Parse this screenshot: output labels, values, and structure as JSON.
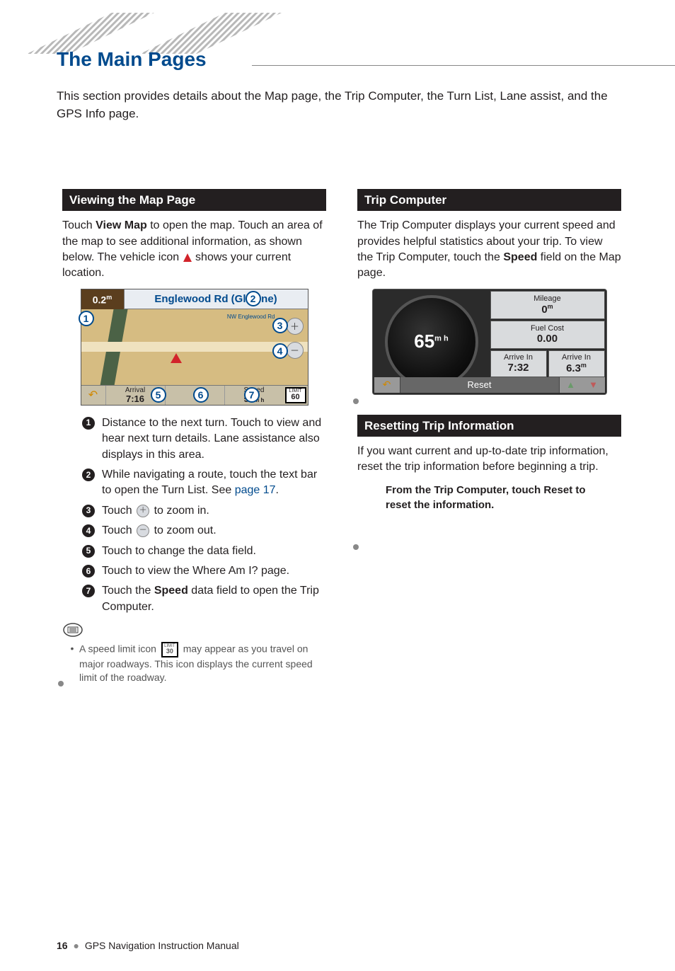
{
  "header": {
    "title": "The Main Pages"
  },
  "intro": "This section provides details about the Map page, the Trip Computer, the Turn List, Lane assist, and the GPS Info page.",
  "left": {
    "section_title": "Viewing the Map Page",
    "para_parts": {
      "p1a": "Touch ",
      "p1b": "View Map",
      "p1c": " to open the map. Touch an area of the map to see additional information, as shown below. The vehicle icon ",
      "p1d": " shows your current location."
    },
    "map": {
      "distance": "0.2",
      "distance_unit": "m",
      "street": "Englewood Rd (Glad    ne)",
      "substreet": "NW Englewood Rd",
      "arrival_label": "Arrival",
      "arrival_value": "7:16",
      "speed_label": "Speed",
      "speed_value": "59",
      "speed_unit": "m h",
      "limit_label": "LIMIT",
      "limit_value": "60"
    },
    "callouts": [
      "1",
      "2",
      "3",
      "4",
      "5",
      "6",
      "7"
    ],
    "list": [
      "Distance to the next turn. Touch to view and hear next turn details. Lane assistance also displays in this area.",
      "While navigating a route, touch the text bar to open the Turn List. See ",
      "Touch        to zoom in.",
      "Touch        to zoom out.",
      "Touch to change the data field.",
      "Touch to view the Where Am I? page.",
      "Touch the "
    ],
    "list_extras": {
      "link_page17": "page 17",
      "period": ".",
      "speed_bold": "Speed",
      "item7_tail": " data field to open the Trip Computer."
    },
    "tip": {
      "pre": "A speed limit icon ",
      "sign_top": "LIMIT",
      "sign_val": "30",
      "post": " may appear as you travel on major roadways. This icon displays the current speed limit of the roadway."
    }
  },
  "right": {
    "section1_title": "Trip Computer",
    "para1_parts": {
      "a": "The Trip Computer displays your current speed and provides helpful statistics about your trip. To view the Trip Computer, touch the ",
      "b": "Speed",
      "c": " field on the Map page."
    },
    "trip": {
      "speed_val": "65",
      "speed_unit": "m h",
      "mileage_label": "Mileage",
      "mileage_value": "0",
      "mileage_unit": "m",
      "fuel_label": "Fuel Cost",
      "fuel_value": "0.00",
      "arrive_label": "Arrive In",
      "arrive_time": "7:32",
      "arrive_dist": "6.3",
      "arrive_dist_unit": "m",
      "reset": "Reset"
    },
    "section2_title": "Resetting Trip Information",
    "para2": "If you want current and up-to-date trip information, reset the trip information before beginning a trip.",
    "instruction": "From the Trip Computer, touch Reset to reset the information."
  },
  "footer": {
    "page": "16",
    "title": "GPS Navigation Instruction Manual"
  }
}
